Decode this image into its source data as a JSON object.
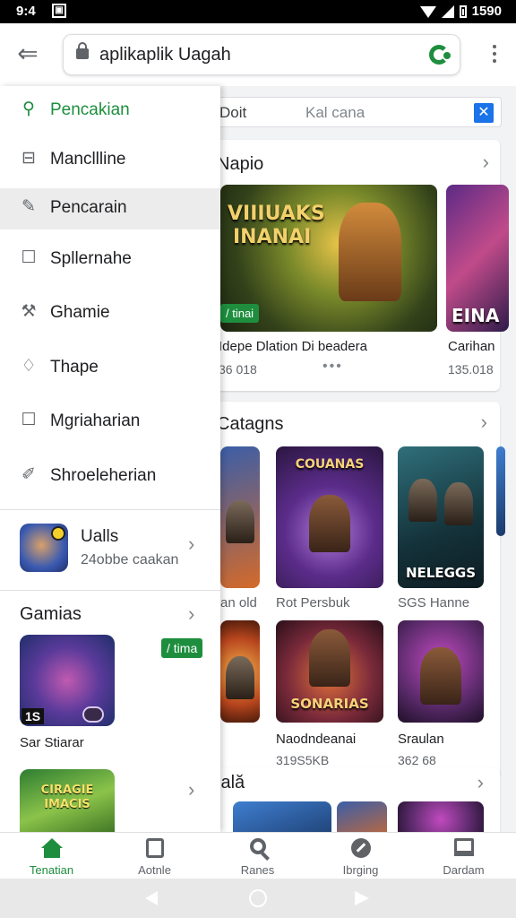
{
  "status_bar": {
    "time": "9:4",
    "battery": "1590",
    "notif_icon": "image-icon"
  },
  "toolbar": {
    "url": "aplikaplik Uagah",
    "back_icon": "arrow-left-icon",
    "refresh_icon": "refresh-icon",
    "menu_icon": "more-vert-icon"
  },
  "search": {
    "left_label": "Doit",
    "placeholder": "Kal cana"
  },
  "sections": {
    "featured": {
      "title": "Napio",
      "banner_text_line1": "VIIIUAKS",
      "banner_text_line2": "INANAI",
      "banner_badge": "/ tinai",
      "banner2_text": "EINA",
      "item1_caption": "Idepe Dlation Di beadera",
      "item1_sub": "36 018",
      "item2_caption": "Carihan",
      "item2_sub": "135.018"
    },
    "categories": {
      "title": "Catagns",
      "tile_b_text": "COUANAS",
      "tile_c_text": "NELEGGS",
      "tile_e_text": "SONARIAS",
      "row1": [
        {
          "caption": "an old",
          "sub": ""
        },
        {
          "caption": "Rot Persbuk",
          "sub": ""
        },
        {
          "caption": "SGS Hanne",
          "sub": ""
        }
      ],
      "row2": [
        {
          "caption": "",
          "sub": ""
        },
        {
          "caption": "Naodndeanai",
          "sub": "319S5KB"
        },
        {
          "caption": "Sraulan",
          "sub": "362 68"
        }
      ]
    },
    "third": {
      "title": "lală"
    }
  },
  "drawer": {
    "menu": [
      {
        "label": "Pencakian",
        "icon": "search-icon",
        "state": "active"
      },
      {
        "label": "Mancllline",
        "icon": "minus-square-icon",
        "state": ""
      },
      {
        "label": "Pencarain",
        "icon": "pencil-icon",
        "state": "selected"
      },
      {
        "label": "Spllernahe",
        "icon": "square-icon",
        "state": ""
      },
      {
        "label": "Ghamie",
        "icon": "wrench-icon",
        "state": ""
      },
      {
        "label": "Thape",
        "icon": "tag-icon",
        "state": ""
      },
      {
        "label": "Mgriaharian",
        "icon": "square-icon",
        "state": ""
      },
      {
        "label": "Shroeleherian",
        "icon": "pen-icon",
        "state": ""
      }
    ],
    "downloads": {
      "title": "Ualls",
      "subtitle": "24obbe caakan"
    },
    "games": {
      "title": "Gamias",
      "tile1_label": "1S",
      "tile1_caption": "Sar Stiarar",
      "badge": "/ tima",
      "tile2_text_line1": "CIRAGIE",
      "tile2_text_line2": "IMACIS"
    }
  },
  "bottom_nav": [
    {
      "label": "Tenatian",
      "icon": "home-icon",
      "active": true
    },
    {
      "label": "Aotnle",
      "icon": "apps-icon",
      "active": false
    },
    {
      "label": "Ranes",
      "icon": "search-icon",
      "active": false
    },
    {
      "label": "Ibrging",
      "icon": "explore-icon",
      "active": false
    },
    {
      "label": "Dardam",
      "icon": "inbox-icon",
      "active": false
    }
  ],
  "colors": {
    "accent": "#1e8e3e",
    "selected_bg": "#ececec",
    "link_blue": "#1a73e8"
  }
}
